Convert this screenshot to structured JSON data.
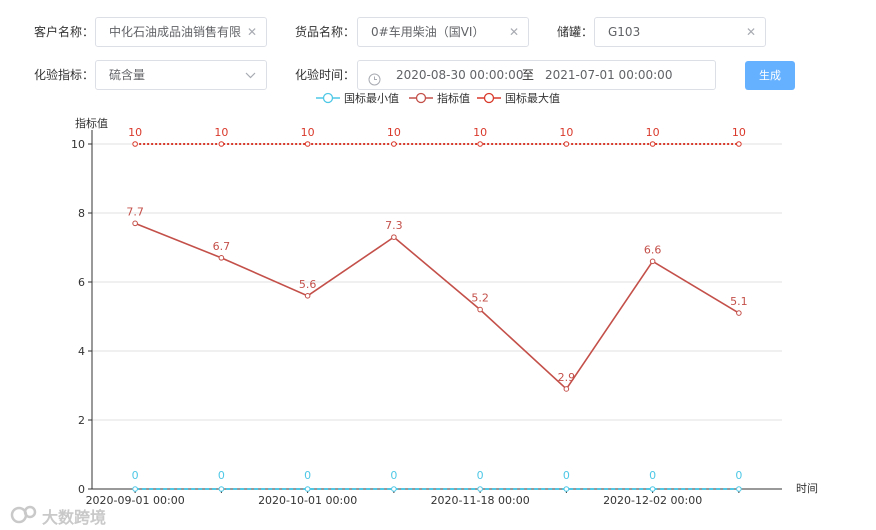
{
  "form": {
    "customer_label": "客户名称：",
    "customer_value": "中化石油成品油销售有限",
    "goods_label": "货品名称：",
    "goods_value": "0#车用柴油（国VI）",
    "tank_label": "储罐：",
    "tank_value": "G103",
    "indicator_label": "化验指标：",
    "indicator_value": "硫含量",
    "time_label": "化验时间：",
    "time_start": "2020-08-30 00:00:00",
    "time_sep": "至",
    "time_end": "2021-07-01 00:00:00",
    "generate_label": "生成",
    "clear_icon": "close-icon",
    "dropdown_icon": "chevron-down-icon",
    "clock_icon": "clock-icon"
  },
  "colors": {
    "primary_button": "#66b1ff",
    "min_series": "#4fc8e6",
    "value_series": "#c4504a",
    "max_series": "#d9392b"
  },
  "chart_data": {
    "type": "line",
    "ylabel": "指标值",
    "xlabel": "时间",
    "ylim": [
      0,
      10
    ],
    "yticks": [
      0,
      2,
      4,
      6,
      8,
      10
    ],
    "grid": true,
    "legend_position": "top-center",
    "x": [
      "2020-09-01 00:00",
      "",
      "2020-10-01 00:00",
      "",
      "2020-11-18 00:00",
      "",
      "2020-12-02 00:00",
      ""
    ],
    "x_tick_labels": [
      "2020-09-01 00:00",
      "2020-10-01 00:00",
      "2020-11-18 00:00",
      "2020-12-02 00:00"
    ],
    "series": [
      {
        "name": "国标最小值",
        "values": [
          0,
          0,
          0,
          0,
          0,
          0,
          0,
          0
        ],
        "style": "dashed",
        "labels": true
      },
      {
        "name": "指标值",
        "values": [
          7.7,
          6.7,
          5.6,
          7.3,
          5.2,
          2.9,
          6.6,
          5.1
        ],
        "style": "solid",
        "labels": true
      },
      {
        "name": "国标最大值",
        "values": [
          10,
          10,
          10,
          10,
          10,
          10,
          10,
          10
        ],
        "style": "dotted",
        "labels": true
      }
    ]
  },
  "watermark": {
    "text": "大数跨境",
    "icon": "logo-icon"
  }
}
